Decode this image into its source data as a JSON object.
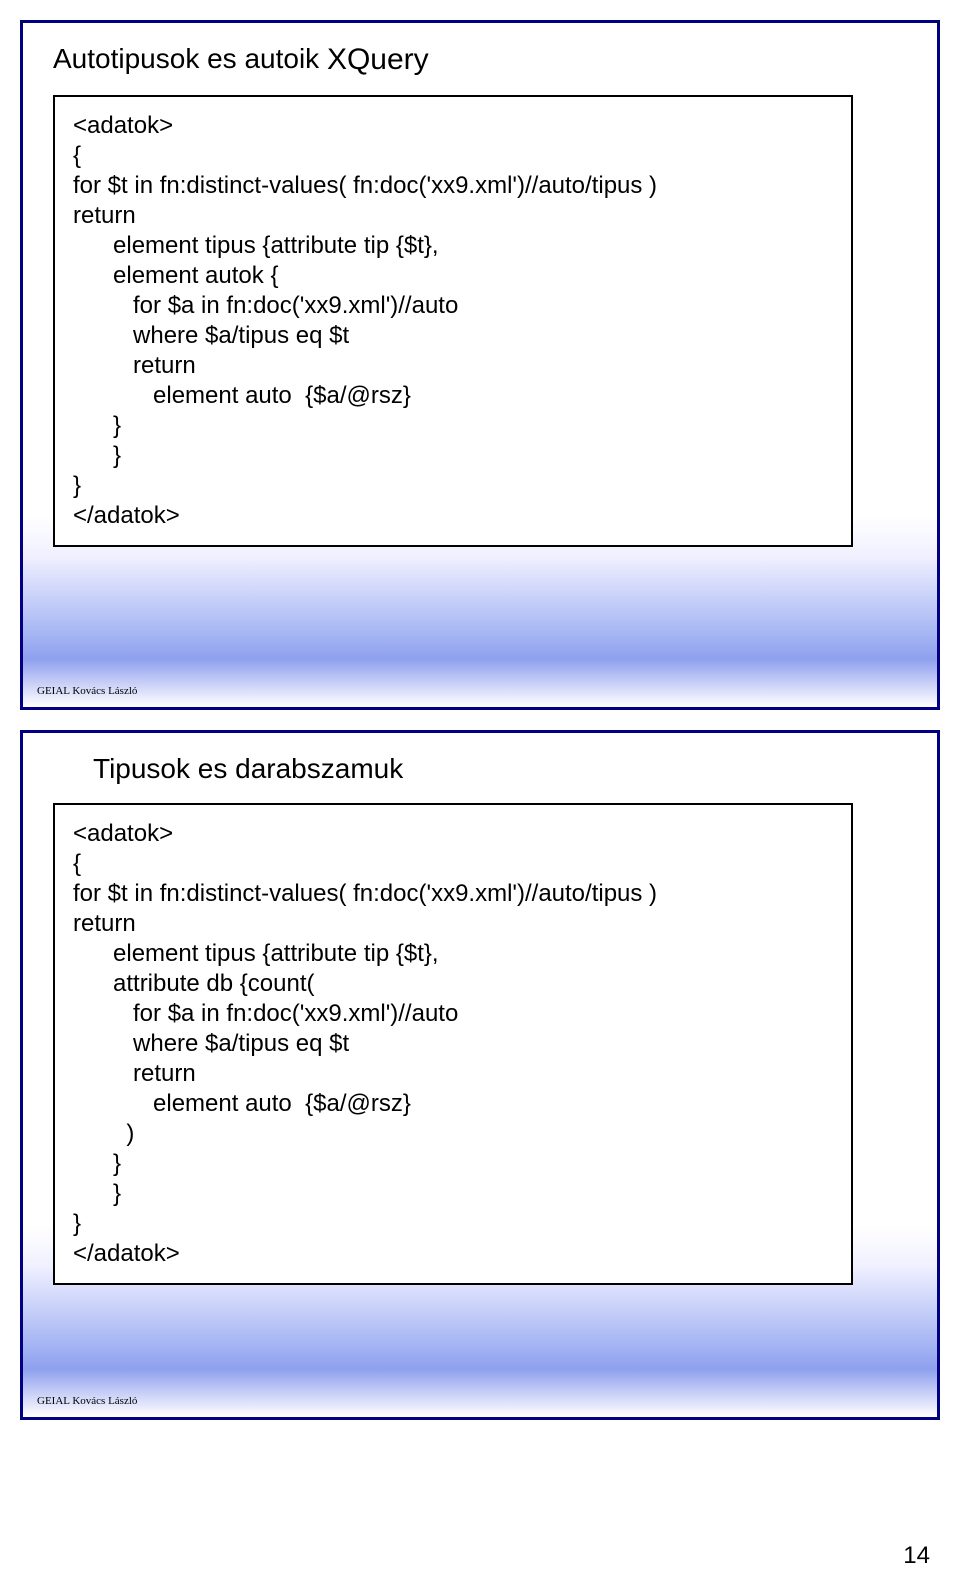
{
  "slide1": {
    "titleLeft": "Autotipusok es autoik",
    "titleRight": "XQuery",
    "code": "<adatok>\n{\nfor $t in fn:distinct-values( fn:doc('xx9.xml')//auto/tipus )\nreturn\n      element tipus {attribute tip {$t},\n      element autok {\n         for $a in fn:doc('xx9.xml')//auto\n         where $a/tipus eq $t\n         return\n            element auto  {$a/@rsz}\n      }\n      }\n}\n</adatok>",
    "footer": "GEIAL Kovács László"
  },
  "slide2": {
    "subtitle": "Tipusok es darabszamuk",
    "code": "<adatok>\n{\nfor $t in fn:distinct-values( fn:doc('xx9.xml')//auto/tipus )\nreturn\n      element tipus {attribute tip {$t},\n      attribute db {count(\n         for $a in fn:doc('xx9.xml')//auto\n         where $a/tipus eq $t\n         return\n            element auto  {$a/@rsz}\n        )\n      }\n      }\n}\n</adatok>",
    "footer": "GEIAL Kovács László"
  },
  "pageNumber": "14"
}
